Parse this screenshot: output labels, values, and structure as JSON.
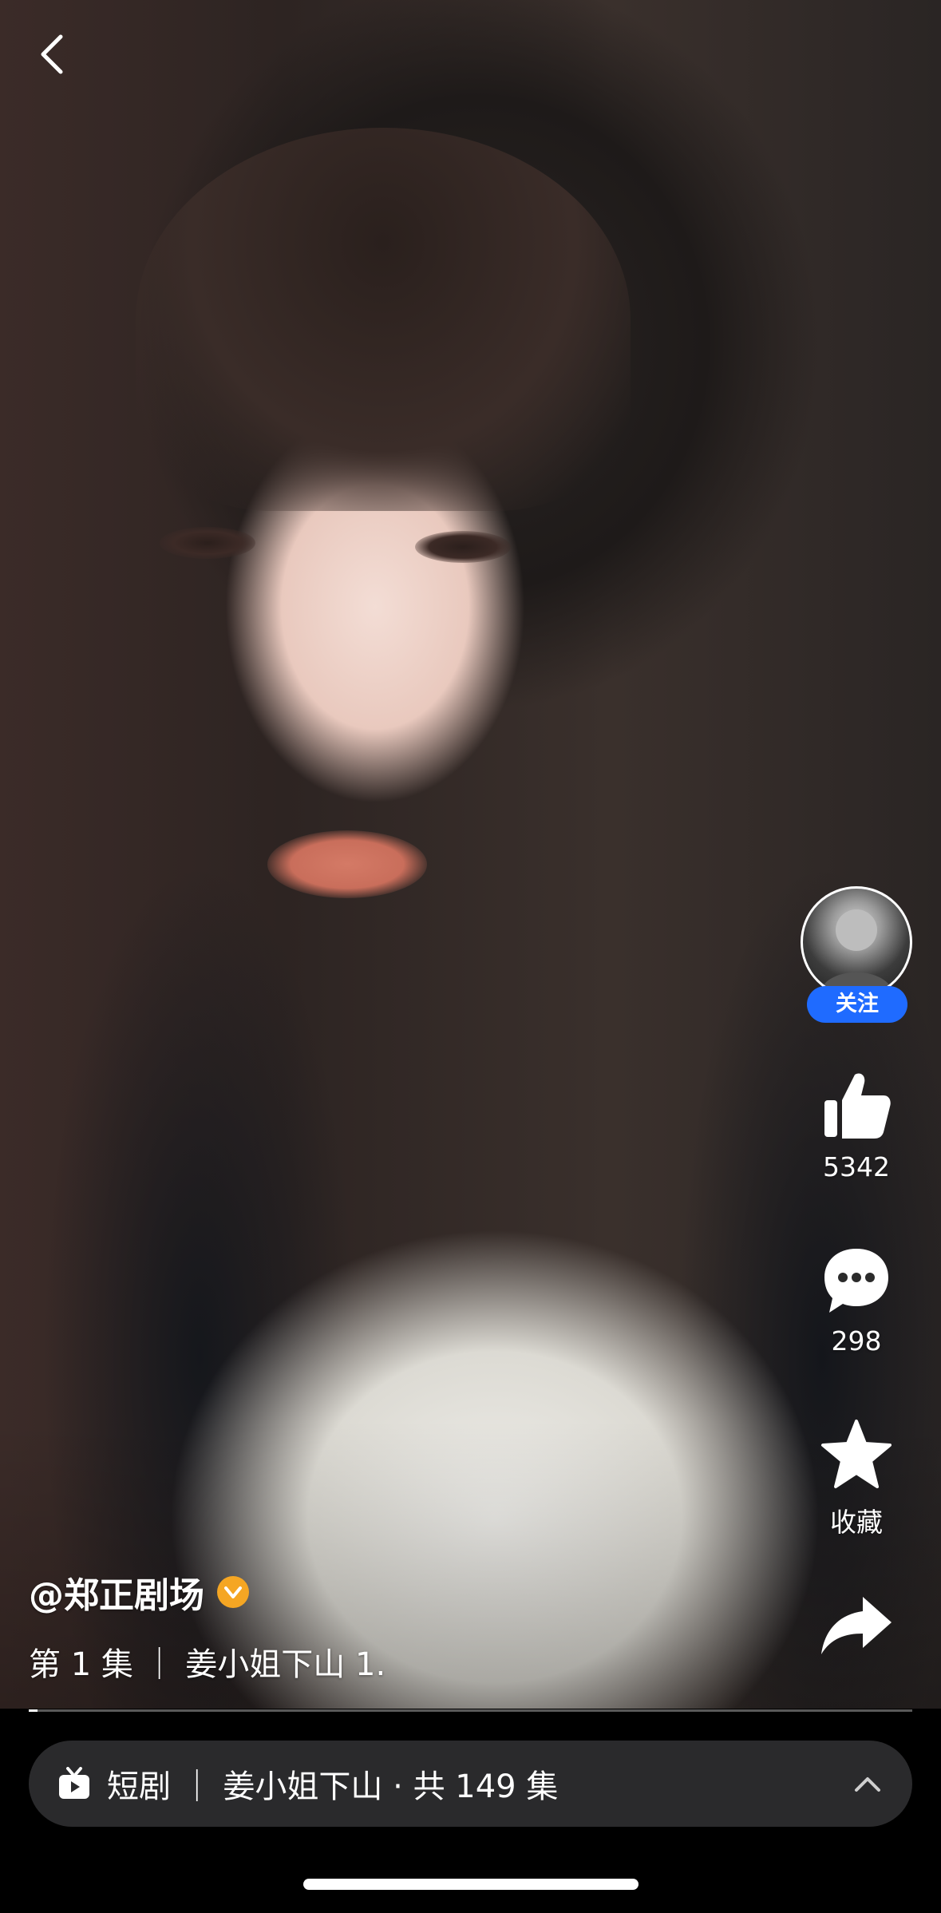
{
  "header": {
    "back_icon": "chevron-left-icon"
  },
  "creator": {
    "handle": "@郑正剧场",
    "follow_label": "关注"
  },
  "actions": {
    "like_count": "5342",
    "comment_count": "298",
    "favorite_label": "收藏"
  },
  "episode": {
    "title": "第 1 集 ｜ 姜小姐下山 1."
  },
  "playback": {
    "progress_fraction": 0.01
  },
  "drama_bar": {
    "text": "短剧 ｜ 姜小姐下山 · 共 149 集"
  },
  "colors": {
    "follow_blue": "#1f6bff",
    "verified_gold": "#f5a623",
    "bar_bg": "#2a2a2c"
  }
}
